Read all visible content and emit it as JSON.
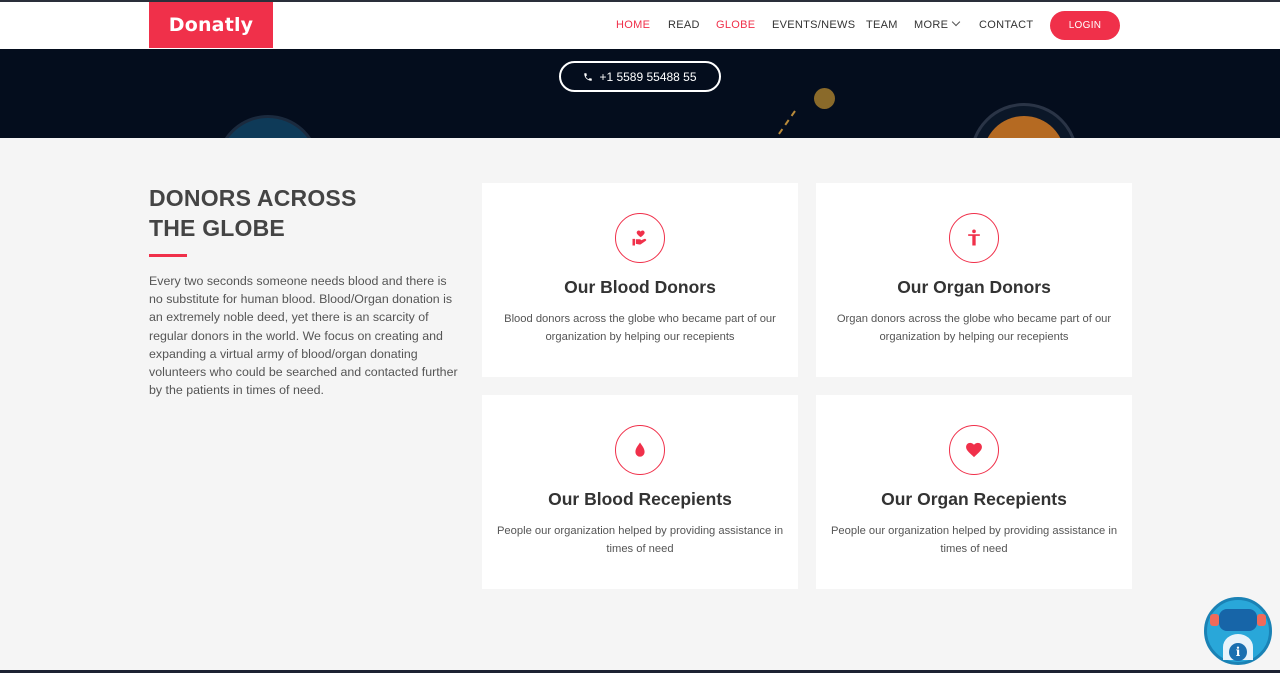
{
  "brand": {
    "name": "Donatly",
    "color": "#f0304a"
  },
  "nav": {
    "items": [
      {
        "label": "HOME",
        "active": true
      },
      {
        "label": "READ",
        "active": false
      },
      {
        "label": "GLOBE",
        "active": true
      },
      {
        "label": "EVENTS/NEWS",
        "active": false
      },
      {
        "label": "TEAM",
        "active": false
      },
      {
        "label": "MORE",
        "active": false
      },
      {
        "label": "CONTACT",
        "active": false
      }
    ],
    "login_label": "LOGIN"
  },
  "hero": {
    "phone": "+1 5589 55488 55"
  },
  "section": {
    "title_line1": "DONORS ACROSS",
    "title_line2": "THE GLOBE",
    "description": "Every two seconds someone needs blood and there is no substitute for human blood. Blood/Organ donation is an extremely noble deed, yet there is an scarcity of regular donors in the world. We focus on creating and expanding a virtual army of blood/organ donating volunteers who could be searched and contacted further by the patients in times of need."
  },
  "cards": [
    {
      "title": "Our Blood Donors",
      "text": "Blood donors across the globe who became part of our organization by helping our recepients",
      "icon": "hand-heart-icon"
    },
    {
      "title": "Our Organ Donors",
      "text": "Organ donors across the globe who became part of our organization by helping our recepients",
      "icon": "person-icon"
    },
    {
      "title": "Our Blood Recepients",
      "text": "People our organization helped by providing assistance in times of need",
      "icon": "blood-drop-icon"
    },
    {
      "title": "Our Organ Recepients",
      "text": "People our organization helped by providing assistance in times of need",
      "icon": "heart-icon"
    }
  ]
}
